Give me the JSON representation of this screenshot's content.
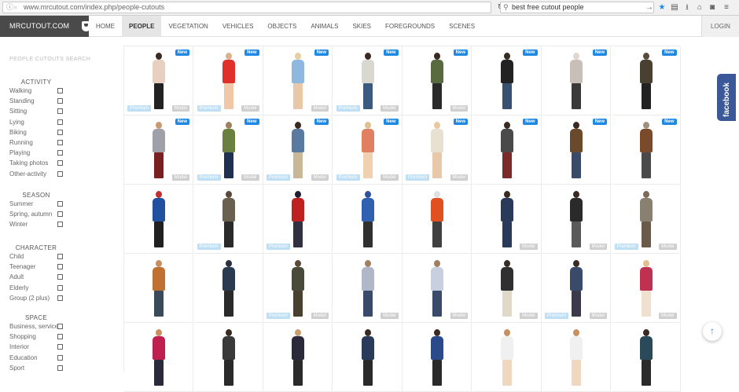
{
  "browser": {
    "url": "www.mrcutout.com/index.php/people-cutouts",
    "search_text": "best free cutout people"
  },
  "nav": {
    "logo": "MRCUTOUT.COM",
    "links": [
      "HOME",
      "PEOPLE",
      "VEGETATION",
      "VEHICLES",
      "OBJECTS",
      "ANIMALS",
      "SKIES",
      "FOREGROUNDS",
      "SCENES"
    ],
    "active": "PEOPLE",
    "login": "LOGIN"
  },
  "sidebar": {
    "title": "PEOPLE CUTOUTS SEARCH",
    "groups": [
      {
        "heading": "ACTIVITY",
        "items": [
          "Walking",
          "Standing",
          "Sitting",
          "Lying",
          "Biking",
          "Running",
          "Playing",
          "Taking photos",
          "Other-activity"
        ]
      },
      {
        "heading": "SEASON",
        "items": [
          "Summer",
          "Spring, autumn",
          "Winter"
        ]
      },
      {
        "heading": "CHARACTER",
        "items": [
          "Child",
          "Teenager",
          "Adult",
          "Elderly",
          "Group (2 plus)"
        ]
      },
      {
        "heading": "SPACE",
        "items": [
          "Business, services",
          "Shopping",
          "Interior",
          "Education",
          "Sport"
        ]
      }
    ]
  },
  "social": {
    "label": "facebook"
  },
  "badges": {
    "new": "New",
    "premium": "Premium",
    "model": "Model"
  },
  "grid": {
    "rows": [
      [
        {
          "new": true,
          "premium": true,
          "model": true,
          "colors": [
            "#3a2a22",
            "#e8d0c0",
            "#222"
          ]
        },
        {
          "new": true,
          "premium": true,
          "model": true,
          "colors": [
            "#d9b48a",
            "#e0302c",
            "#f0c8a8"
          ]
        },
        {
          "new": true,
          "premium": false,
          "model": true,
          "colors": [
            "#e6cfa0",
            "#8fb8e0",
            "#e8c8a8"
          ]
        },
        {
          "new": true,
          "premium": true,
          "model": true,
          "colors": [
            "#3a2a22",
            "#d8d8d0",
            "#3a5a80"
          ]
        },
        {
          "new": true,
          "premium": false,
          "model": true,
          "colors": [
            "#3a2a22",
            "#5a6a40",
            "#2a2a2a"
          ]
        },
        {
          "new": true,
          "premium": false,
          "model": false,
          "colors": [
            "#3a2a22",
            "#222",
            "#3a5070"
          ]
        },
        {
          "new": true,
          "premium": false,
          "model": false,
          "colors": [
            "#e0d8d0",
            "#c8c0b8",
            "#3a3a3a"
          ]
        },
        {
          "new": true,
          "premium": false,
          "model": false,
          "colors": [
            "#5a4a3a",
            "#4a4030",
            "#222"
          ]
        }
      ],
      [
        {
          "new": true,
          "premium": false,
          "model": true,
          "colors": [
            "#c89a70",
            "#a0a0a8",
            "#7a2020"
          ]
        },
        {
          "new": true,
          "premium": true,
          "model": true,
          "colors": [
            "#a08060",
            "#6a8040",
            "#203050"
          ]
        },
        {
          "new": true,
          "premium": true,
          "model": true,
          "colors": [
            "#3a2a22",
            "#5a7aa0",
            "#c8b898"
          ]
        },
        {
          "new": true,
          "premium": true,
          "model": true,
          "colors": [
            "#e0c090",
            "#e08060",
            "#f0d0b0"
          ]
        },
        {
          "new": true,
          "premium": true,
          "model": true,
          "colors": [
            "#e8c8a0",
            "#e8e0d0",
            "#e8c8a8"
          ]
        },
        {
          "new": true,
          "premium": false,
          "model": false,
          "colors": [
            "#3a2a22",
            "#4a4a4a",
            "#7a2a2a"
          ]
        },
        {
          "new": true,
          "premium": false,
          "model": false,
          "colors": [
            "#3a2a22",
            "#6a4a2a",
            "#3a4a6a"
          ]
        },
        {
          "new": true,
          "premium": false,
          "model": false,
          "colors": [
            "#a09080",
            "#7a4a2a",
            "#4a4a4a"
          ]
        }
      ],
      [
        {
          "new": false,
          "premium": false,
          "model": false,
          "colors": [
            "#c03030",
            "#2050a0",
            "#202020"
          ]
        },
        {
          "new": false,
          "premium": true,
          "model": false,
          "colors": [
            "#5a4a3a",
            "#6a6050",
            "#2a2a2a"
          ]
        },
        {
          "new": false,
          "premium": true,
          "model": false,
          "colors": [
            "#202030",
            "#c02020",
            "#303040"
          ]
        },
        {
          "new": false,
          "premium": false,
          "model": false,
          "colors": [
            "#3050a0",
            "#3060b0",
            "#303030"
          ]
        },
        {
          "new": false,
          "premium": false,
          "model": false,
          "colors": [
            "#e0e0e0",
            "#e05020",
            "#404040"
          ]
        },
        {
          "new": false,
          "premium": false,
          "model": true,
          "colors": [
            "#3a2a22",
            "#2a3a5a",
            "#2a3a5a"
          ]
        },
        {
          "new": false,
          "premium": false,
          "model": true,
          "colors": [
            "#3a2a22",
            "#2a2a2a",
            "#5a5a5a"
          ]
        },
        {
          "new": false,
          "premium": true,
          "model": true,
          "colors": [
            "#7a6a5a",
            "#8a8070",
            "#6a5a4a"
          ]
        }
      ],
      [
        {
          "new": false,
          "premium": false,
          "model": false,
          "colors": [
            "#c89060",
            "#c07030",
            "#3a4a5a"
          ]
        },
        {
          "new": false,
          "premium": false,
          "model": false,
          "colors": [
            "#2a3040",
            "#2a3a50",
            "#2a2a2a"
          ]
        },
        {
          "new": false,
          "premium": true,
          "model": true,
          "colors": [
            "#5a4a3a",
            "#4a4a3a",
            "#4a4030"
          ]
        },
        {
          "new": false,
          "premium": false,
          "model": true,
          "colors": [
            "#a08060",
            "#b0b8c8",
            "#3a4a6a"
          ]
        },
        {
          "new": false,
          "premium": false,
          "model": true,
          "colors": [
            "#a08060",
            "#c8d0e0",
            "#3a4a6a"
          ]
        },
        {
          "new": false,
          "premium": false,
          "model": true,
          "colors": [
            "#3a2a22",
            "#303030",
            "#e0d8c8"
          ]
        },
        {
          "new": false,
          "premium": true,
          "model": true,
          "colors": [
            "#3a2a22",
            "#3a4a6a",
            "#3a3a4a"
          ]
        },
        {
          "new": false,
          "premium": false,
          "model": true,
          "colors": [
            "#e0c090",
            "#c03050",
            "#f0e0d0"
          ]
        }
      ],
      [
        {
          "new": false,
          "premium": false,
          "model": false,
          "colors": [
            "#c89060",
            "#c02050",
            "#2a2a3a"
          ]
        },
        {
          "new": false,
          "premium": false,
          "model": false,
          "colors": [
            "#3a2a22",
            "#3a3a3a",
            "#2a2a2a"
          ]
        },
        {
          "new": false,
          "premium": false,
          "model": false,
          "colors": [
            "#c8a070",
            "#2a2a3a",
            "#2a2a2a"
          ]
        },
        {
          "new": false,
          "premium": false,
          "model": false,
          "colors": [
            "#3a2a22",
            "#2a3a5a",
            "#2a2a2a"
          ]
        },
        {
          "new": false,
          "premium": false,
          "model": false,
          "colors": [
            "#3a2a22",
            "#2a4a8a",
            "#2a2a2a"
          ]
        },
        {
          "new": false,
          "premium": false,
          "model": false,
          "colors": [
            "#c89060",
            "#f0f0f0",
            "#f0d8c0"
          ]
        },
        {
          "new": false,
          "premium": false,
          "model": false,
          "colors": [
            "#c89060",
            "#f0f0f0",
            "#f0d8c0"
          ]
        },
        {
          "new": false,
          "premium": false,
          "model": false,
          "colors": [
            "#3a2a22",
            "#2a4a5a",
            "#2a2a2a"
          ]
        }
      ]
    ]
  }
}
